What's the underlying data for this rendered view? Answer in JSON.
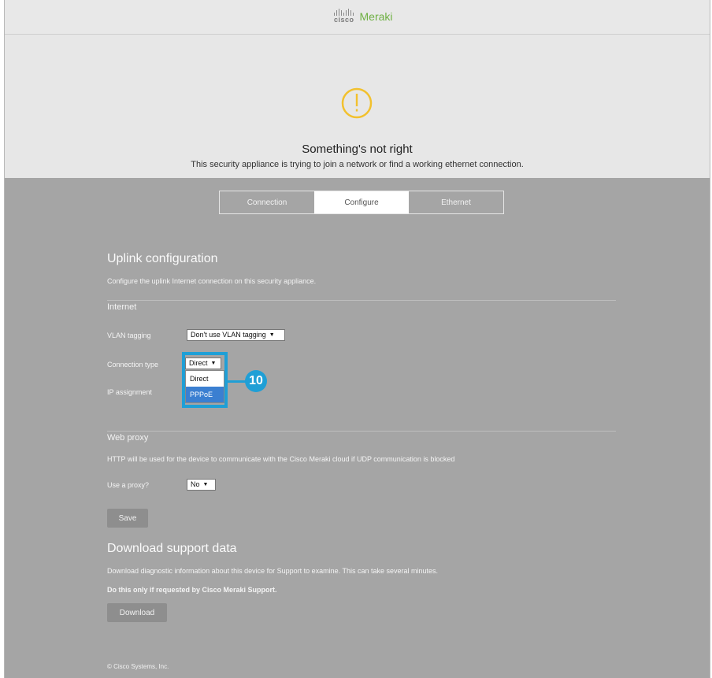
{
  "brand": {
    "cisco": "cisco",
    "product": "Meraki"
  },
  "hero": {
    "title": "Something's not right",
    "subtitle": "This security appliance is trying to join a network or find a working ethernet connection."
  },
  "tabs": [
    {
      "label": "Connection",
      "active": false
    },
    {
      "label": "Configure",
      "active": true
    },
    {
      "label": "Ethernet",
      "active": false
    }
  ],
  "uplink": {
    "title": "Uplink configuration",
    "description": "Configure the uplink Internet connection on this security appliance.",
    "internet_label": "Internet",
    "vlan_label": "VLAN tagging",
    "vlan_value": "Don't use VLAN tagging",
    "conn_type_label": "Connection type",
    "conn_type_value": "Direct",
    "conn_type_options": [
      "Direct",
      "PPPoE"
    ],
    "conn_type_highlighted": "PPPoE",
    "ip_label": "IP assignment",
    "callout_number": "10"
  },
  "web_proxy": {
    "title": "Web proxy",
    "description": "HTTP will be used for the device to communicate with the Cisco Meraki cloud if UDP communication is blocked",
    "use_proxy_label": "Use a proxy?",
    "use_proxy_value": "No",
    "save_label": "Save"
  },
  "support": {
    "title": "Download support data",
    "description": "Download diagnostic information about this device for Support to examine. This can take several minutes.",
    "note": "Do this only if requested by Cisco Meraki Support.",
    "download_label": "Download"
  },
  "footer": {
    "copyright": "© Cisco Systems, Inc."
  },
  "colors": {
    "warning": "#f2c12e",
    "highlight": "#1f9fd6",
    "meraki_green": "#6eb043",
    "selected_option": "#3b7fd1"
  }
}
